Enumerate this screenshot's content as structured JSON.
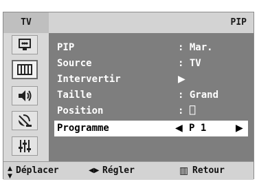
{
  "header": {
    "left_label": "TV",
    "title": "PIP"
  },
  "sidebar": {
    "items": [
      {
        "icon": "picture-icon"
      },
      {
        "icon": "setup-icon"
      },
      {
        "icon": "sound-icon"
      },
      {
        "icon": "channel-antenna-icon"
      },
      {
        "icon": "equalizer-icon"
      }
    ]
  },
  "menu": {
    "rows": [
      {
        "label": "PIP",
        "value": ": Mar."
      },
      {
        "label": "Source",
        "value": ": TV"
      },
      {
        "label": "Intervertir",
        "value": "▶"
      },
      {
        "label": "Taille",
        "value": ": Grand"
      },
      {
        "label": "Position",
        "value": ": ⎕"
      },
      {
        "label": "Programme",
        "value": "P 1",
        "left_arrow": "◀",
        "right_arrow": "▶"
      }
    ]
  },
  "footer": {
    "move_icon": "▲▼",
    "move_label": "Déplacer",
    "adjust_icon": "◀▶",
    "adjust_label": "Régler",
    "return_icon": "▥",
    "return_label": "Retour"
  },
  "colors": {
    "panel": "#c9c9c9",
    "content": "#7e7e7e",
    "selection": "#ffffff"
  }
}
